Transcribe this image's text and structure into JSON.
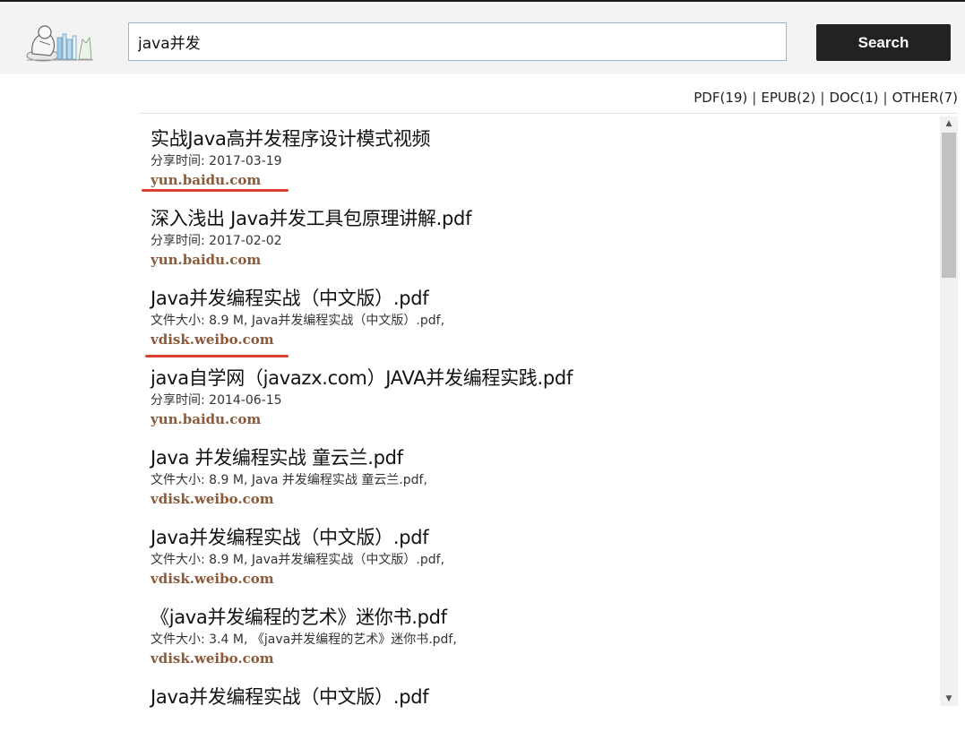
{
  "search": {
    "query": "java并发",
    "button_label": "Search"
  },
  "filters": [
    {
      "label": "PDF(19)"
    },
    {
      "label": "EPUB(2)"
    },
    {
      "label": "DOC(1)"
    },
    {
      "label": "OTHER(7)"
    }
  ],
  "filter_separator": "|",
  "results": [
    {
      "title": "实战Java高并发程序设计模式视频",
      "meta": "分享时间: 2017-03-19",
      "source": "yun.baidu.com"
    },
    {
      "title": "深入浅出 Java并发工具包原理讲解.pdf",
      "meta": "分享时间: 2017-02-02",
      "source": "yun.baidu.com"
    },
    {
      "title": "Java并发编程实战（中文版）.pdf",
      "meta": "文件大小: 8.9 M, Java并发编程实战（中文版）.pdf,",
      "source": "vdisk.weibo.com"
    },
    {
      "title": "java自学网（javazx.com）JAVA并发编程实践.pdf",
      "meta": "分享时间: 2014-06-15",
      "source": "yun.baidu.com"
    },
    {
      "title": "Java 并发编程实战 童云兰.pdf",
      "meta": "文件大小: 8.9 M, Java 并发编程实战 童云兰.pdf,",
      "source": "vdisk.weibo.com"
    },
    {
      "title": "Java并发编程实战（中文版）.pdf",
      "meta": "文件大小: 8.9 M, Java并发编程实战（中文版）.pdf,",
      "source": "vdisk.weibo.com"
    },
    {
      "title": "《java并发编程的艺术》迷你书.pdf",
      "meta": "文件大小: 3.4 M, 《java并发编程的艺术》迷你书.pdf,",
      "source": "vdisk.weibo.com"
    },
    {
      "title": "Java并发编程实战（中文版）.pdf",
      "meta": "",
      "source": ""
    }
  ],
  "colors": {
    "source_link": "#8a5a3a",
    "annotation_underline": "#d9402e",
    "button_bg": "#222222"
  }
}
